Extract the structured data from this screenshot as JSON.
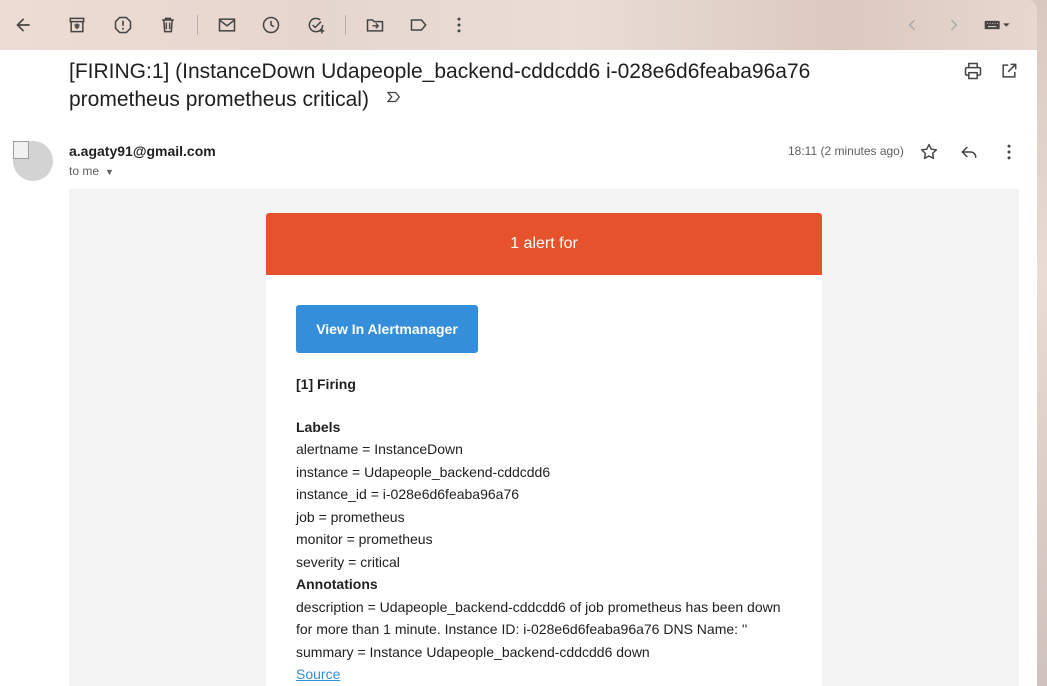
{
  "toolbar": {
    "back_icon": "arrow-left-icon",
    "archive_icon": "archive-icon",
    "report_spam_icon": "report-icon",
    "delete_icon": "trash-icon",
    "mark_unread_icon": "mail-icon",
    "snooze_icon": "clock-icon",
    "add_task_icon": "add-task-icon",
    "move_to_icon": "folder-move-icon",
    "labels_icon": "label-icon",
    "more_icon": "more-vert-icon",
    "newer_icon": "chevron-left-icon",
    "older_icon": "chevron-right-icon",
    "input_tools_icon": "keyboard-icon"
  },
  "email": {
    "subject_line1": "[FIRING:1] (InstanceDown Udapeople_backend-cddcdd6 i-028e6d6feaba96a76",
    "subject_line2": "prometheus prometheus critical)",
    "sender": "a.agaty91@gmail.com",
    "recipient": "to me",
    "time": "18:11 (2 minutes ago)"
  },
  "alert": {
    "header": "1 alert for",
    "button_label": "View In Alertmanager",
    "firing": "[1] Firing",
    "labels_heading": "Labels",
    "labels": [
      "alertname = InstanceDown",
      "instance = Udapeople_backend-cddcdd6",
      "instance_id = i-028e6d6feaba96a76",
      "job = prometheus",
      "monitor = prometheus",
      "severity = critical"
    ],
    "annotations_heading": "Annotations",
    "annotations": [
      "description = Udapeople_backend-cddcdd6 of job prometheus has been down",
      "for more than 1 minute. Instance ID: i-028e6d6feaba96a76 DNS Name: ''",
      "summary = Instance Udapeople_backend-cddcdd6 down"
    ],
    "source_link": "Source"
  },
  "colors": {
    "alert_header": "#e6522c",
    "button": "#348eda",
    "link": "#348eda"
  }
}
